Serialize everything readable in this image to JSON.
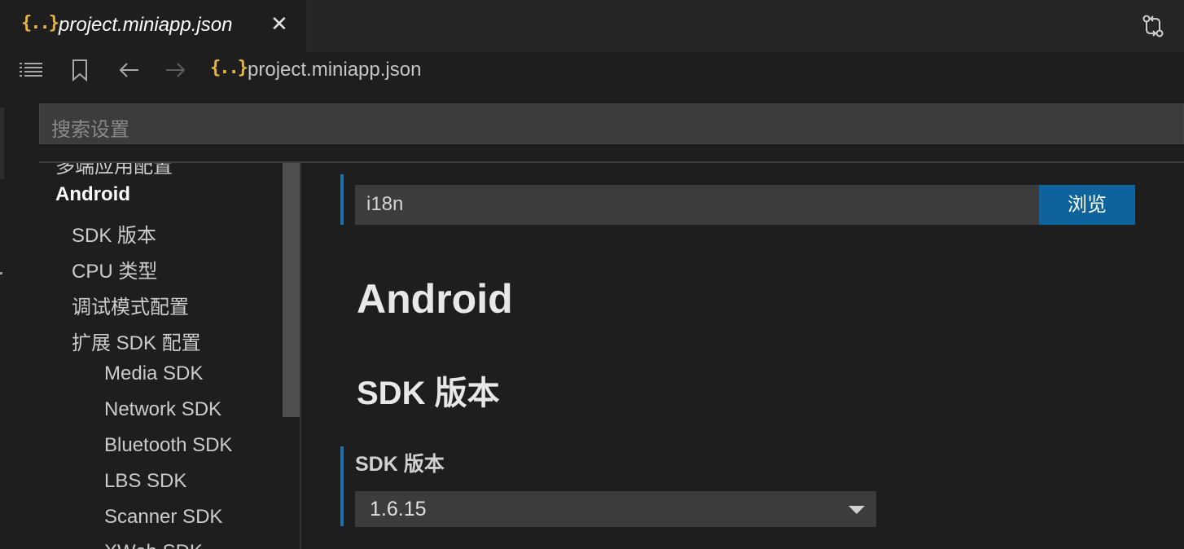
{
  "tab": {
    "icon": "{..}",
    "title": "project.miniapp.json",
    "close": "✕"
  },
  "breadcrumb": {
    "icon": "{..}",
    "label": "project.miniapp.json"
  },
  "search": {
    "placeholder": "搜索设置"
  },
  "toc": {
    "items": [
      "多端应用配置",
      "Android",
      "SDK 版本",
      "CPU 类型",
      "调试模式配置",
      "扩展 SDK 配置",
      "Media SDK",
      "Network SDK",
      "Bluetooth SDK",
      "LBS SDK",
      "Scanner SDK",
      "XWeb SDK"
    ]
  },
  "content": {
    "path_value": "i18n",
    "browse_label": "浏览",
    "section_title": "Android",
    "subsection_title": "SDK 版本",
    "setting_label": "SDK 版本",
    "select_value": "1.6.15"
  },
  "icons": {
    "outline": "list-icon",
    "bookmark": "bookmark-icon",
    "back": "arrow-left-icon",
    "forward": "arrow-right-icon",
    "compare": "git-compare-icon"
  },
  "colors": {
    "accent": "#0e639c",
    "json_icon": "#e8b545",
    "modified_bar": "#1e6ea7"
  }
}
